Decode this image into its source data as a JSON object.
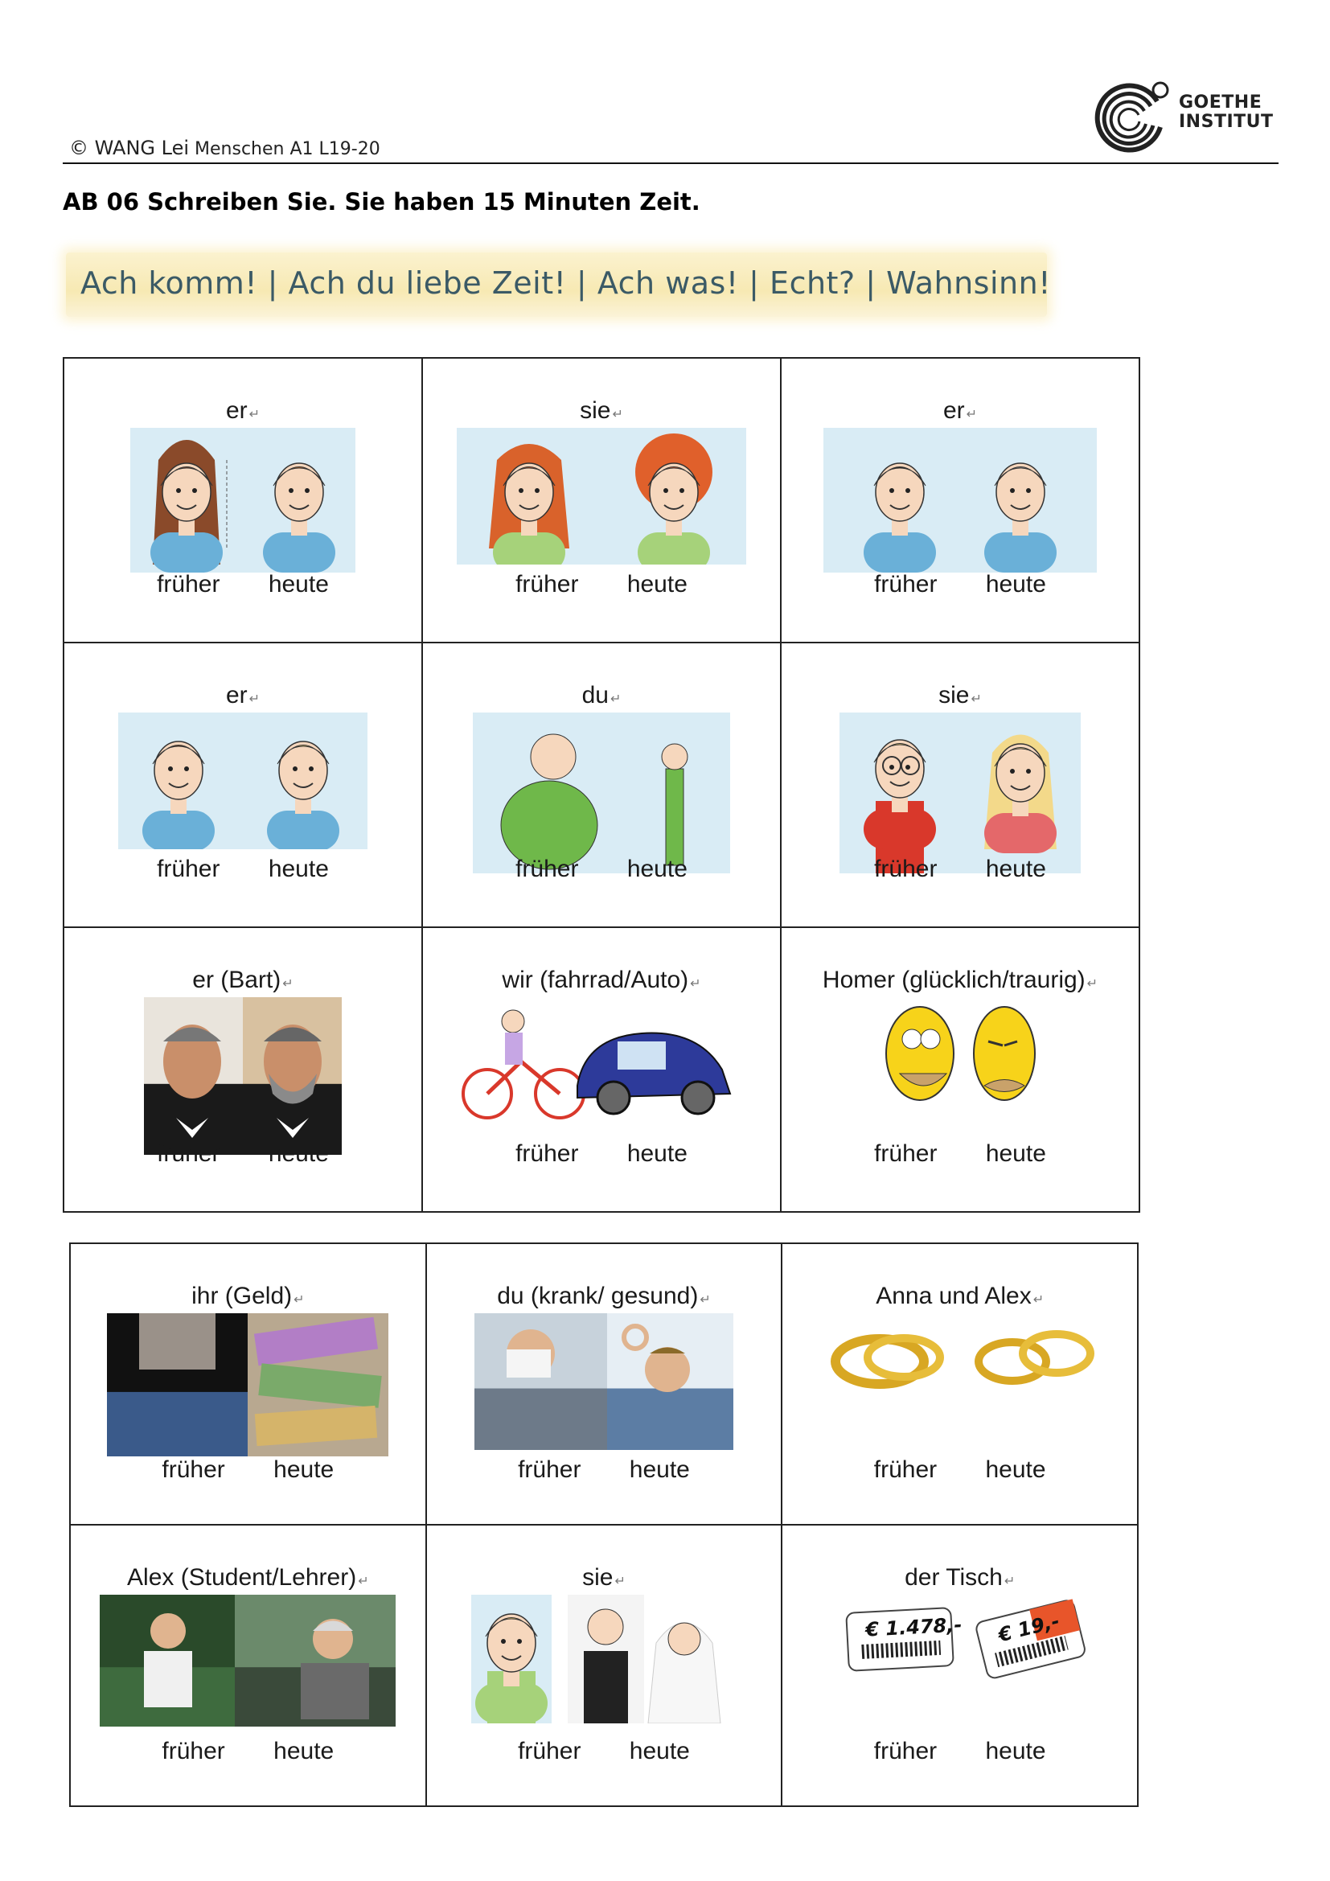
{
  "header": {
    "copyright": "© WANG Lei",
    "course": "Menschen A1 L19-20",
    "logo_line1": "GOETHE",
    "logo_line2": "INSTITUT"
  },
  "task": {
    "title": "AB 06 Schreiben Sie. Sie haben 15  Minuten Zeit."
  },
  "expressions": "Ach komm! | Ach du liebe Zeit! | Ach was! | Echt? | Wahnsinn!",
  "labels": {
    "before": "früher",
    "now": "heute"
  },
  "mark": "↵",
  "grid1": [
    {
      "title": "er",
      "pic": "hair-long-short"
    },
    {
      "title": "sie",
      "pic": "straight-curly"
    },
    {
      "title": "er",
      "pic": "dark-grey-hair"
    },
    {
      "title": "er",
      "pic": "brown-blond-hair"
    },
    {
      "title": "du",
      "pic": "fat-thin"
    },
    {
      "title": "sie",
      "pic": "glasses-pretty"
    },
    {
      "title": "er (Bart)",
      "pic": "beard-photo"
    },
    {
      "title": "wir (fahrrad/Auto)",
      "pic": "bike-car"
    },
    {
      "title": "Homer (glücklich/traurig)",
      "pic": "homer"
    }
  ],
  "grid2": [
    {
      "title": "ihr (Geld)",
      "pic": "money"
    },
    {
      "title": "du (krank/ gesund)",
      "pic": "sick-healthy"
    },
    {
      "title": "Anna und Alex",
      "pic": "rings"
    },
    {
      "title": "Alex (Student/Lehrer)",
      "pic": "student-teacher"
    },
    {
      "title": "sie",
      "pic": "wedding"
    },
    {
      "title": "der Tisch",
      "pic": "price-tags"
    }
  ],
  "price_tags": {
    "before": "€ 1.478,-",
    "now": "€ 19,-"
  }
}
